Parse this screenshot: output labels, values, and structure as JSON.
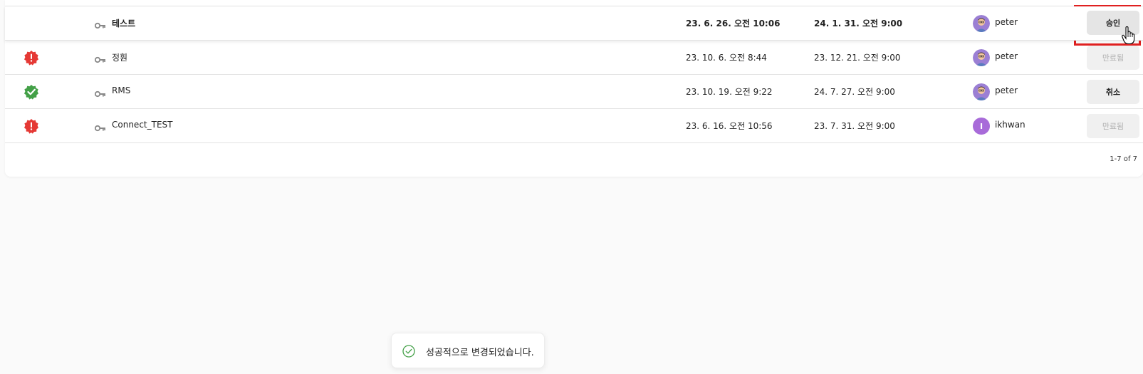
{
  "rows": [
    {
      "status": "",
      "name": "테스트",
      "created": "23. 6. 26. 오전 10:06",
      "expires": "24. 1. 31. 오전 9:00",
      "user": "peter",
      "avatar_type": "photo",
      "action": "승인"
    },
    {
      "status": "error",
      "name": "정훤",
      "created": "23. 10. 6. 오전 8:44",
      "expires": "23. 12. 21. 오전 9:00",
      "user": "peter",
      "avatar_type": "photo",
      "action": "만료됨"
    },
    {
      "status": "success",
      "name": "RMS",
      "created": "23. 10. 19. 오전 9:22",
      "expires": "24. 7. 27. 오전 9:00",
      "user": "peter",
      "avatar_type": "photo",
      "action": "취소"
    },
    {
      "status": "error",
      "name": "Connect_TEST",
      "created": "23. 6. 16. 오전 10:56",
      "expires": "23. 7. 31. 오전 9:00",
      "user": "ikhwan",
      "avatar_type": "initial",
      "avatar_initial": "I",
      "action": "만료됨"
    }
  ],
  "pagination": {
    "label": "1-7 of 7"
  },
  "toast": {
    "message": "성공적으로 변경되었습니다."
  },
  "colors": {
    "error": "#e53935",
    "success": "#43a047",
    "avatar_initial_bg": "#a86bd9",
    "highlight": "#e02020"
  },
  "icons": {
    "status_error": "error-badge-icon",
    "status_success": "verified-badge-icon",
    "key": "key-icon",
    "cursor": "hand-pointer-icon",
    "toast_check": "check-circle-icon"
  }
}
